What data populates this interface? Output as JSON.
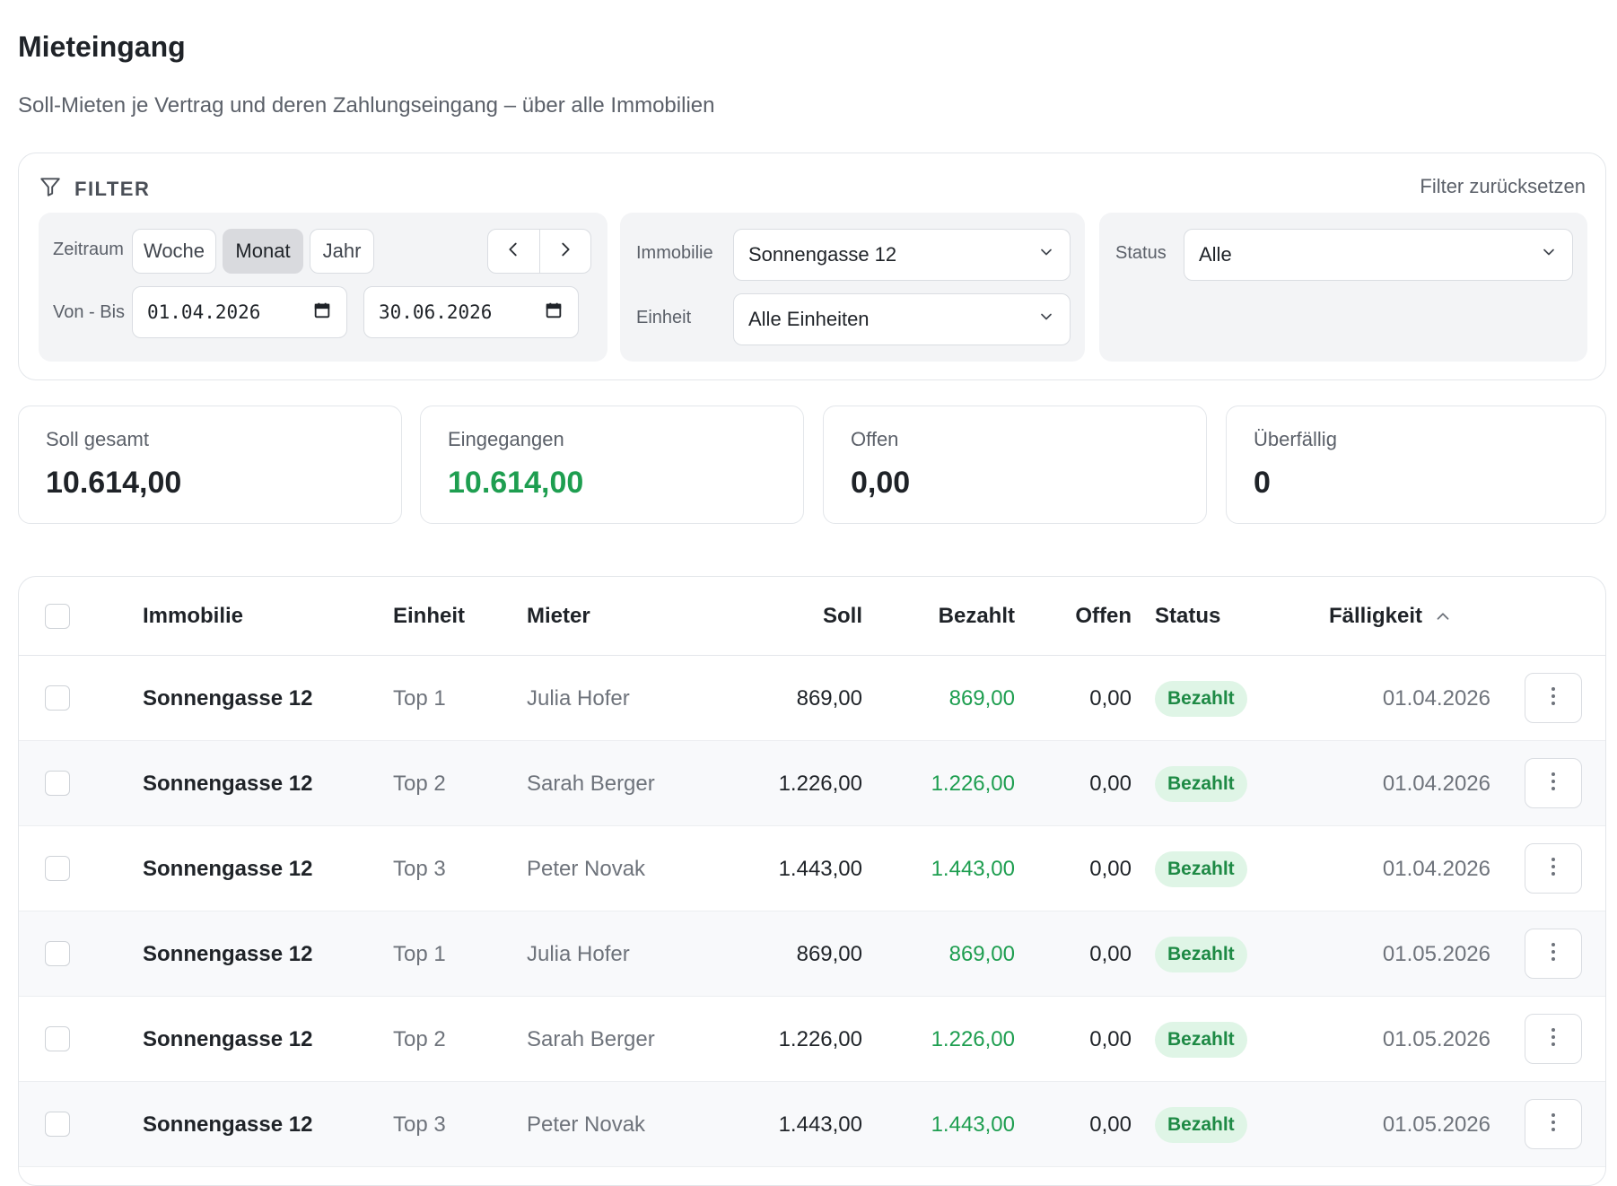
{
  "page": {
    "title": "Mieteingang",
    "subtitle": "Soll-Mieten je Vertrag und deren Zahlungseingang – über alle Immobilien"
  },
  "filter": {
    "heading": "FILTER",
    "reset_label": "Filter zurücksetzen",
    "zeitraum_label": "Zeitraum",
    "segments": [
      "Woche",
      "Monat",
      "Jahr"
    ],
    "active_segment": "Monat",
    "von_bis_label": "Von - Bis",
    "date_from": "01.04.2026",
    "date_to": "30.06.2026",
    "immobilie_label": "Immobilie",
    "immobilie_value": "Sonnengasse 12",
    "einheit_label": "Einheit",
    "einheit_value": "Alle Einheiten",
    "status_label": "Status",
    "status_value": "Alle"
  },
  "stats": [
    {
      "label": "Soll gesamt",
      "value": "10.614,00"
    },
    {
      "label": "Eingegangen",
      "value": "10.614,00"
    },
    {
      "label": "Offen",
      "value": "0,00"
    },
    {
      "label": "Überfällig",
      "value": "0"
    }
  ],
  "table": {
    "columns": {
      "immobilie": "Immobilie",
      "einheit": "Einheit",
      "mieter": "Mieter",
      "soll": "Soll",
      "bezahlt": "Bezahlt",
      "offen": "Offen",
      "status": "Status",
      "faelligkeit": "Fälligkeit"
    },
    "rows": [
      {
        "immobilie": "Sonnengasse 12",
        "einheit": "Top 1",
        "mieter": "Julia Hofer",
        "soll": "869,00",
        "bezahlt": "869,00",
        "offen": "0,00",
        "status": "Bezahlt",
        "faelligkeit": "01.04.2026"
      },
      {
        "immobilie": "Sonnengasse 12",
        "einheit": "Top 2",
        "mieter": "Sarah Berger",
        "soll": "1.226,00",
        "bezahlt": "1.226,00",
        "offen": "0,00",
        "status": "Bezahlt",
        "faelligkeit": "01.04.2026"
      },
      {
        "immobilie": "Sonnengasse 12",
        "einheit": "Top 3",
        "mieter": "Peter Novak",
        "soll": "1.443,00",
        "bezahlt": "1.443,00",
        "offen": "0,00",
        "status": "Bezahlt",
        "faelligkeit": "01.04.2026"
      },
      {
        "immobilie": "Sonnengasse 12",
        "einheit": "Top 1",
        "mieter": "Julia Hofer",
        "soll": "869,00",
        "bezahlt": "869,00",
        "offen": "0,00",
        "status": "Bezahlt",
        "faelligkeit": "01.05.2026"
      },
      {
        "immobilie": "Sonnengasse 12",
        "einheit": "Top 2",
        "mieter": "Sarah Berger",
        "soll": "1.226,00",
        "bezahlt": "1.226,00",
        "offen": "0,00",
        "status": "Bezahlt",
        "faelligkeit": "01.05.2026"
      },
      {
        "immobilie": "Sonnengasse 12",
        "einheit": "Top 3",
        "mieter": "Peter Novak",
        "soll": "1.443,00",
        "bezahlt": "1.443,00",
        "offen": "0,00",
        "status": "Bezahlt",
        "faelligkeit": "01.05.2026"
      }
    ]
  },
  "colors": {
    "accent_green": "#1e9e50",
    "badge_bg": "#dff5e6",
    "border": "#e3e6ea"
  },
  "icons": {
    "filter": "funnel-icon",
    "prev": "chevron-left-icon",
    "next": "chevron-right-icon",
    "calendar": "calendar-icon",
    "dropdown": "chevron-down-icon",
    "sort": "chevron-up-icon",
    "row_menu": "kebab-icon"
  }
}
